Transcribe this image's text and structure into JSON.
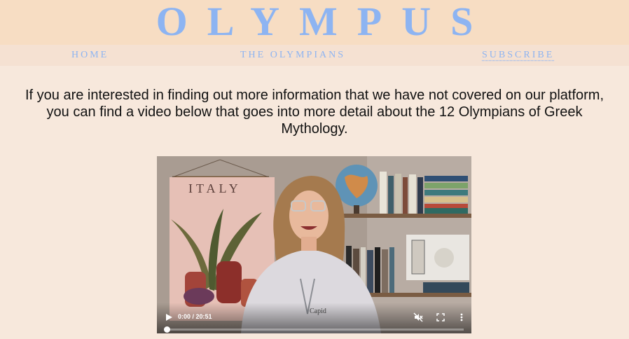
{
  "site": {
    "logo": "OLYMPUS"
  },
  "nav": {
    "home": "HOME",
    "olympians": "THE OLYMPIANS",
    "subscribe": "SUBSCRIBE"
  },
  "main": {
    "intro": "If you are interested in finding out more information that we have not covered on our platform, you can find a video below that goes into more detail about the 12 Olympians of Greek Mythology."
  },
  "video": {
    "time": "0:00 / 20:51",
    "progress": 0,
    "poster_banner_text": "ITALY",
    "icons": {
      "play": "play-icon",
      "mute": "mute-icon",
      "fullscreen": "fullscreen-icon",
      "more": "more-vertical-icon"
    }
  },
  "colors": {
    "header_bg": "#f7ddc3",
    "nav_bg": "#f5e1d2",
    "page_bg": "#f7e8dc",
    "accent": "#8db4f2",
    "text": "#111111"
  }
}
